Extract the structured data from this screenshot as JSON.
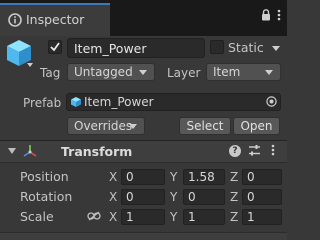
{
  "window": {
    "tab_title": "Inspector"
  },
  "header": {
    "object_name": "Item_Power",
    "active": true,
    "static_label": "Static",
    "static_checked": false,
    "tag_label": "Tag",
    "tag_value": "Untagged",
    "layer_label": "Layer",
    "layer_value": "Item"
  },
  "prefab": {
    "label": "Prefab",
    "asset_name": "Item_Power",
    "overrides_label": "Overrides",
    "select_label": "Select",
    "open_label": "Open"
  },
  "transform": {
    "title": "Transform",
    "help_glyph": "?",
    "rows": [
      {
        "label": "Position",
        "x": "0",
        "y": "1.58",
        "z": "0"
      },
      {
        "label": "Rotation",
        "x": "0",
        "y": "0",
        "z": "0"
      },
      {
        "label": "Scale",
        "x": "1",
        "y": "1",
        "z": "1"
      }
    ],
    "axis_labels": {
      "x": "X",
      "y": "Y",
      "z": "Z"
    }
  },
  "colors": {
    "accent": "#3a79bb",
    "cube": "#5cc6ff",
    "background": "#383838"
  },
  "icons": [
    "inspector-icon",
    "lock-icon",
    "more-icon",
    "cube-icon",
    "target-icon",
    "transform-icon",
    "help-icon",
    "presets-icon",
    "link-icon"
  ]
}
